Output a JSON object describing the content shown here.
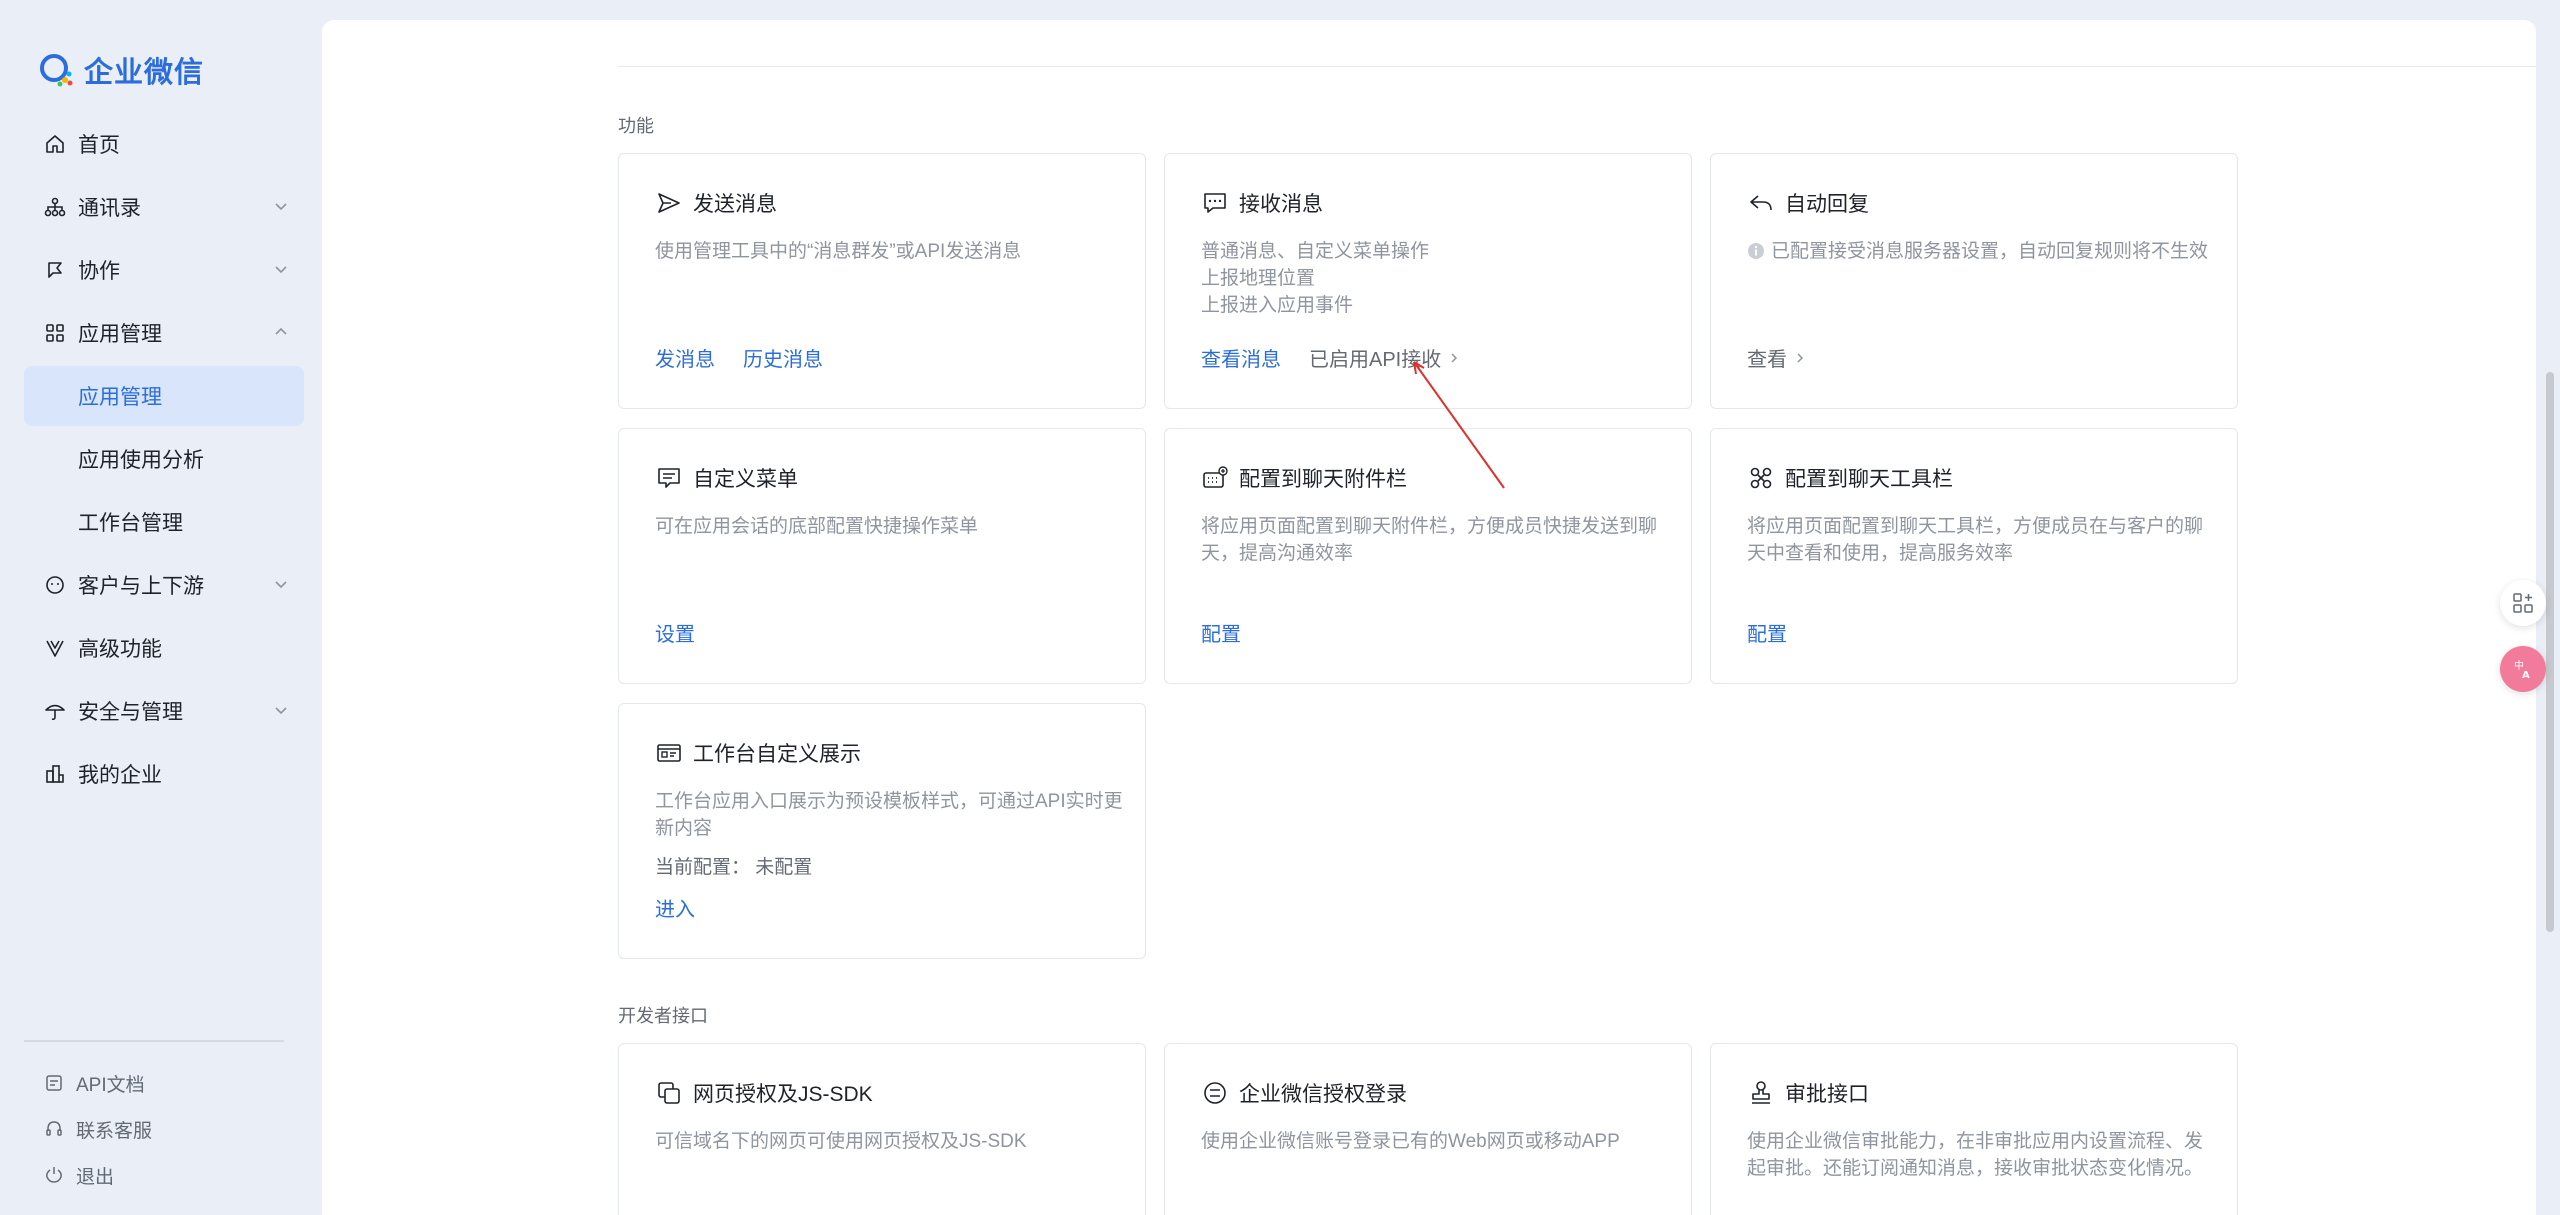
{
  "app": {
    "logo_text": "企业微信"
  },
  "sidebar": {
    "items": [
      {
        "label": "首页"
      },
      {
        "label": "通讯录"
      },
      {
        "label": "协作"
      },
      {
        "label": "应用管理"
      },
      {
        "label": "应用管理"
      },
      {
        "label": "应用使用分析"
      },
      {
        "label": "工作台管理"
      },
      {
        "label": "客户与上下游"
      },
      {
        "label": "高级功能"
      },
      {
        "label": "安全与管理"
      },
      {
        "label": "我的企业"
      }
    ],
    "bottom": [
      {
        "label": "API文档"
      },
      {
        "label": "联系客服"
      },
      {
        "label": "退出"
      }
    ]
  },
  "sections": {
    "features": "功能",
    "developer": "开发者接口"
  },
  "cards": {
    "send": {
      "title": "发送消息",
      "desc": "使用管理工具中的“消息群发”或API发送消息",
      "link1": "发消息",
      "link2": "历史消息"
    },
    "receive": {
      "title": "接收消息",
      "desc1": "普通消息、自定义菜单操作",
      "desc2": "上报地理位置",
      "desc3": "上报进入应用事件",
      "link1": "查看消息",
      "link2": "已启用API接收"
    },
    "autoreply": {
      "title": "自动回复",
      "desc": "已配置接受消息服务器设置，自动回复规则将不生效",
      "link1": "查看"
    },
    "menu": {
      "title": "自定义菜单",
      "desc": "可在应用会话的底部配置快捷操作菜单",
      "link1": "设置"
    },
    "attach": {
      "title": "配置到聊天附件栏",
      "desc": "将应用页面配置到聊天附件栏，方便成员快捷发送到聊天，提高沟通效率",
      "link1": "配置"
    },
    "toolbar": {
      "title": "配置到聊天工具栏",
      "desc": "将应用页面配置到聊天工具栏，方便成员在与客户的聊天中查看和使用，提高服务效率",
      "link1": "配置"
    },
    "workbench": {
      "title": "工作台自定义展示",
      "desc": "工作台应用入口展示为预设模板样式，可通过API实时更新内容",
      "config": "当前配置：  未配置",
      "link1": "进入"
    },
    "oauth": {
      "title": "网页授权及JS-SDK",
      "desc": "可信域名下的网页可使用网页授权及JS-SDK"
    },
    "login": {
      "title": "企业微信授权登录",
      "desc": "使用企业微信账号登录已有的Web网页或移动APP"
    },
    "approval": {
      "title": "审批接口",
      "desc": "使用企业微信审批能力，在非审批应用内设置流程、发起审批。还能订阅通知消息，接收审批状态变化情况。"
    }
  },
  "colors": {
    "accent": "#2b6ddd",
    "active_bg": "#d8e5fb",
    "annotation": "#e0302a"
  }
}
